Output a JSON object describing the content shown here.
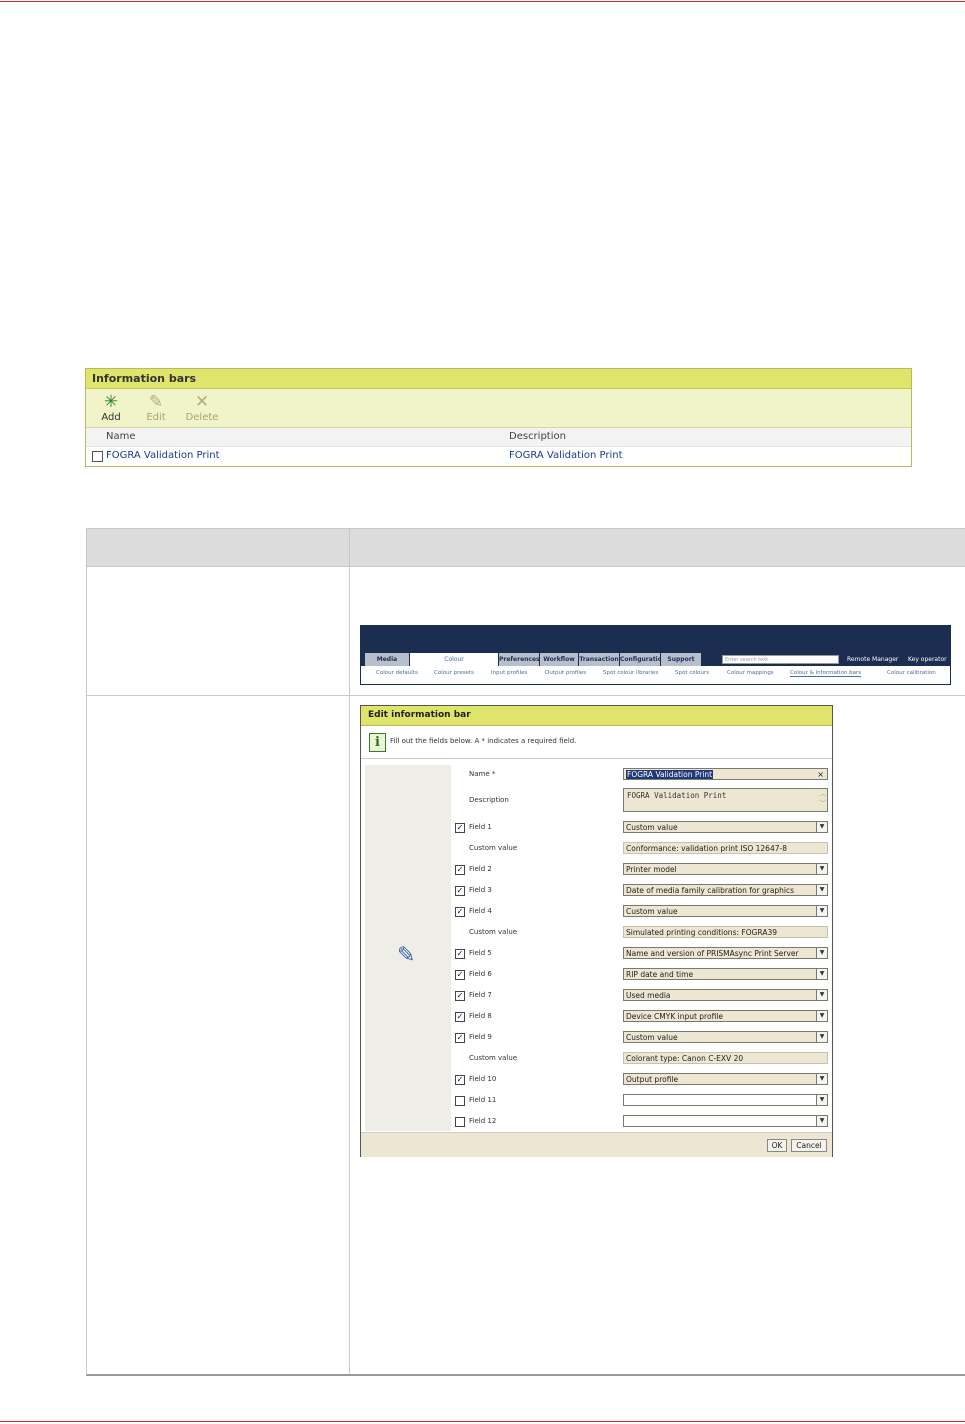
{
  "info_bars": {
    "title": "Information bars",
    "toolbar": {
      "add": "Add",
      "edit": "Edit",
      "delete": "Delete"
    },
    "columns": {
      "name": "Name",
      "description": "Description"
    },
    "rows": [
      {
        "name": "FOGRA Validation Print",
        "description": "FOGRA Validation Print"
      }
    ]
  },
  "tabs": {
    "main": [
      "Media",
      "Colour",
      "Preferences",
      "Workflow",
      "Transaction",
      "Configuratio",
      "Support"
    ],
    "active": "Colour",
    "search_placeholder": "Enter search text",
    "right": [
      "Remote Manager",
      "Key operator"
    ],
    "sub": [
      "Colour defaults",
      "Colour presets",
      "Input profiles",
      "Output profiles",
      "Spot colour libraries",
      "Spot colours",
      "Colour mappings",
      "Colour & information bars",
      "Colour calibration"
    ],
    "sub_active": "Colour & information bars"
  },
  "dialog": {
    "title": "Edit information bar",
    "info": "Fill out the fields below. A * indicates a required field.",
    "name_label": "Name *",
    "name_value": "FOGRA Validation Print",
    "desc_label": "Description",
    "desc_value": "FOGRA Validation Print",
    "fields": [
      {
        "label": "Field 1",
        "value": "Custom value",
        "checked": true
      },
      {
        "label": "Custom value",
        "value": "Conformance: validation print ISO 12647-8"
      },
      {
        "label": "Field 2",
        "value": "Printer model",
        "checked": true
      },
      {
        "label": "Field 3",
        "value": "Date of media family calibration for graphics",
        "checked": true
      },
      {
        "label": "Field 4",
        "value": "Custom value",
        "checked": true
      },
      {
        "label": "Custom value",
        "value": "Simulated printing conditions: FOGRA39"
      },
      {
        "label": "Field 5",
        "value": "Name and version of PRISMAsync Print Server",
        "checked": true
      },
      {
        "label": "Field 6",
        "value": "RIP date and time",
        "checked": true
      },
      {
        "label": "Field 7",
        "value": "Used media",
        "checked": true
      },
      {
        "label": "Field 8",
        "value": "Device CMYK input profile",
        "checked": true
      },
      {
        "label": "Field 9",
        "value": "Custom value",
        "checked": true
      },
      {
        "label": "Custom value",
        "value": "Colorant type: Canon C-EXV 20"
      },
      {
        "label": "Field 10",
        "value": "Output profile",
        "checked": true
      },
      {
        "label": "Field 11",
        "value": "",
        "checked": false
      },
      {
        "label": "Field 12",
        "value": "",
        "checked": false
      }
    ],
    "ok": "OK",
    "cancel": "Cancel"
  }
}
